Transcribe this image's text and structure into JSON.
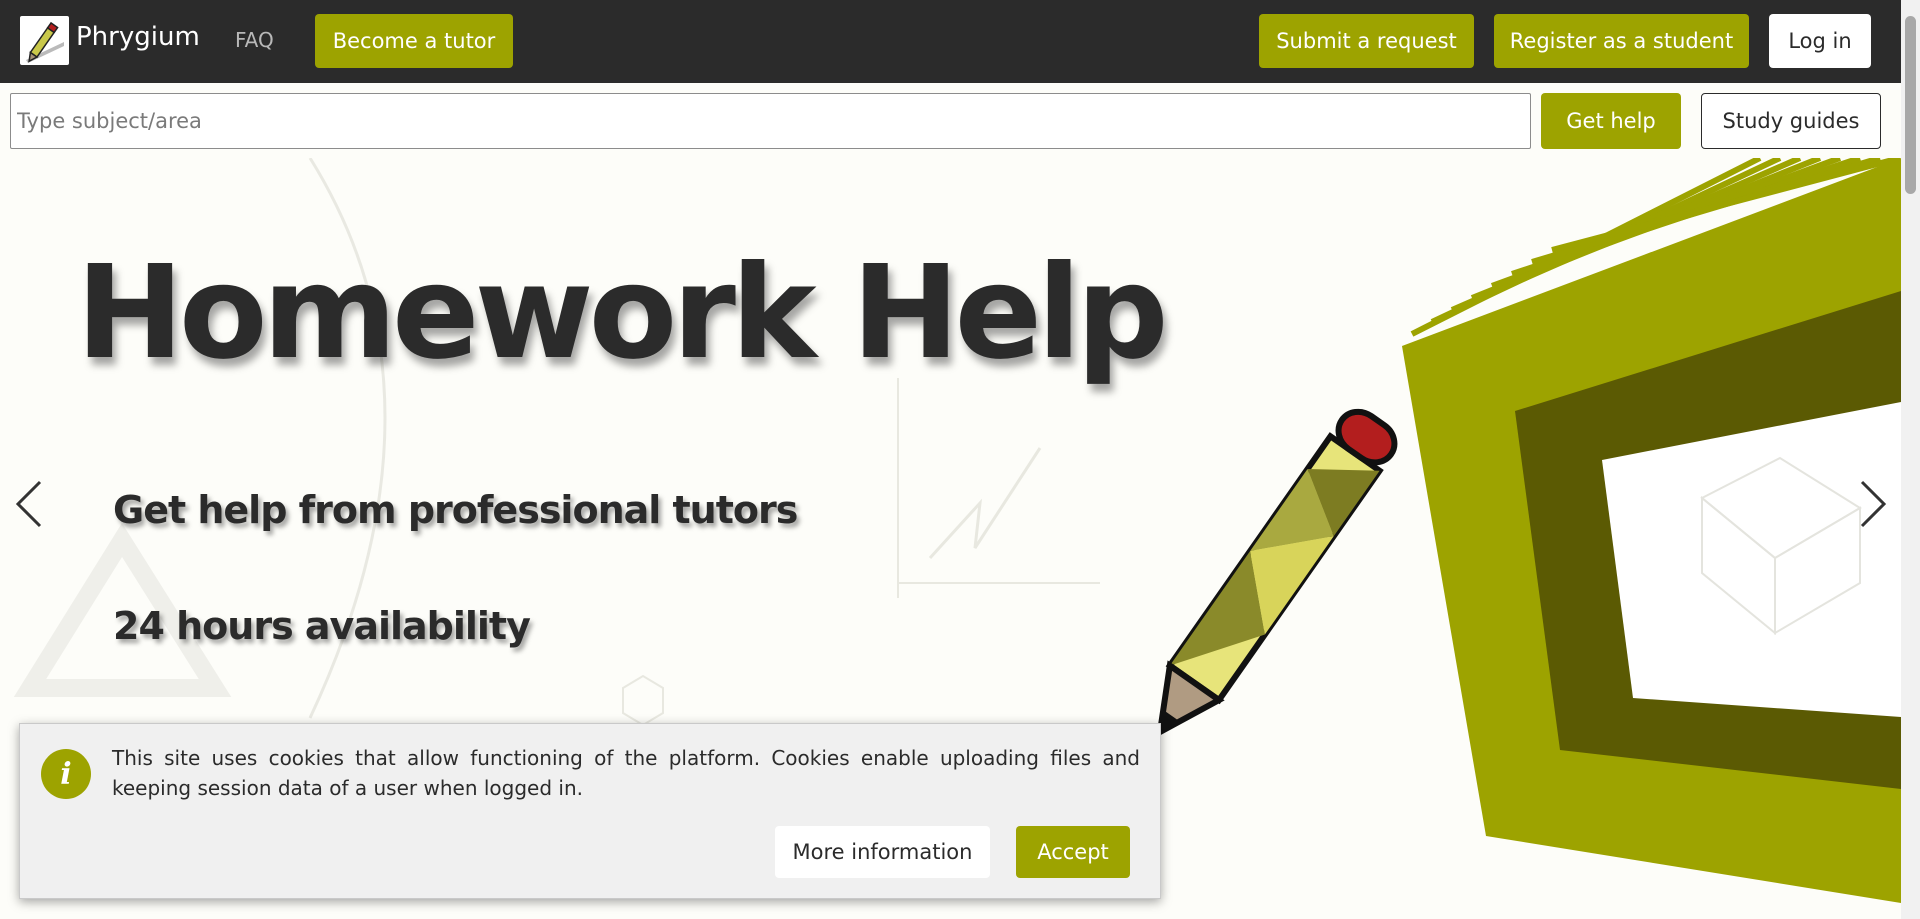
{
  "header": {
    "brand": "Phrygium",
    "faq_label": "FAQ",
    "become_tutor_label": "Become a tutor",
    "submit_request_label": "Submit a request",
    "register_student_label": "Register as a student",
    "login_label": "Log in"
  },
  "search": {
    "placeholder": "Type subject/area",
    "value": "",
    "get_help_label": "Get help",
    "study_guides_label": "Study guides"
  },
  "hero": {
    "title": "Homework Help",
    "line1": "Get help from professional tutors",
    "line2": "24 hours availability"
  },
  "cookie": {
    "text": "This site uses cookies that allow functioning of the platform. Cookies enable uploading files and keeping session data of a user when logged in.",
    "more_info_label": "More information",
    "accept_label": "Accept",
    "icon_glyph": "i"
  },
  "colors": {
    "accent": "#9da300",
    "dark": "#2b2b2b",
    "accent_dark": "#5b5a03"
  },
  "icons": {
    "logo": "pencil-logo-icon",
    "carousel_prev": "chevron-left-icon",
    "carousel_next": "chevron-right-icon",
    "cookie_info": "info-icon"
  }
}
